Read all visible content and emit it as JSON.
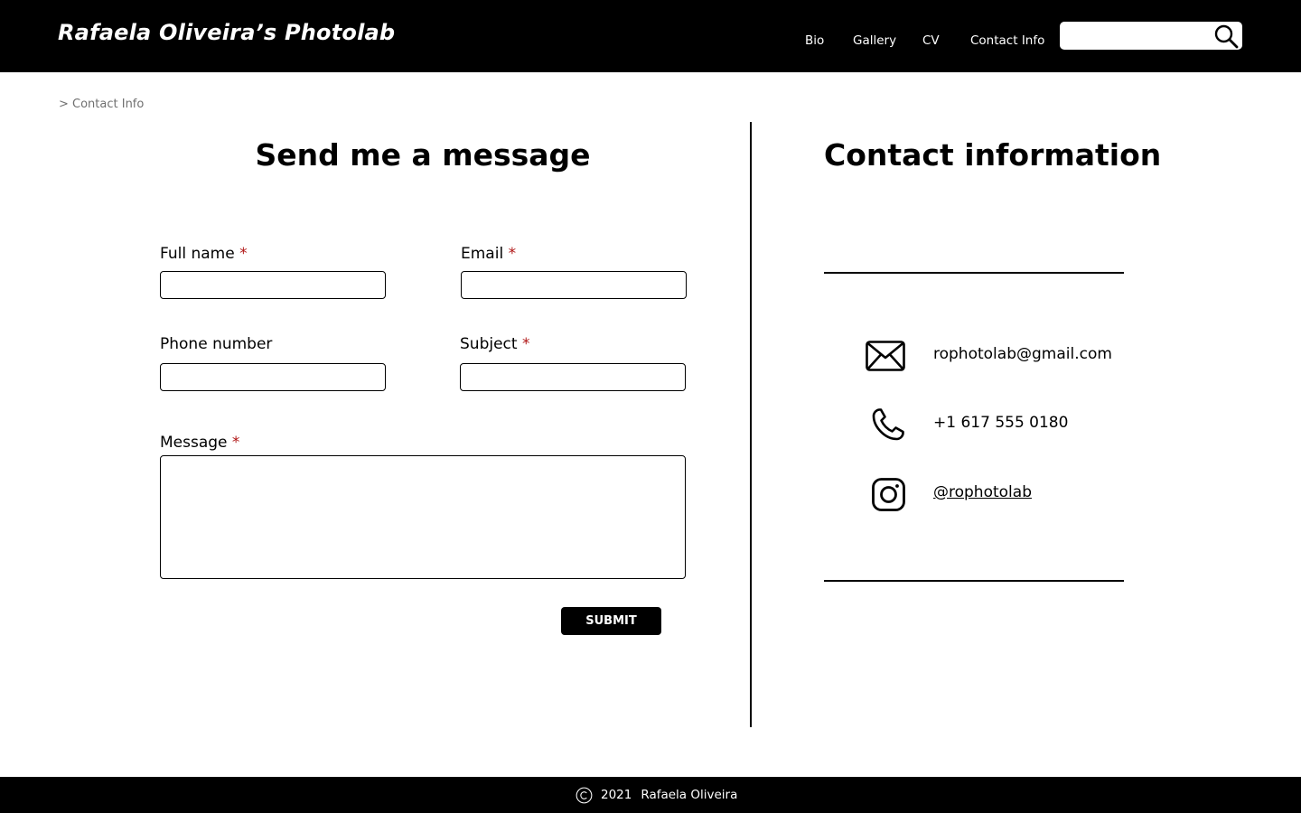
{
  "header": {
    "brand": "Rafaela Oliveira’s Photolab",
    "nav": [
      {
        "label": "Bio"
      },
      {
        "label": "Gallery"
      },
      {
        "label": "CV"
      },
      {
        "label": "Contact Info"
      }
    ],
    "search": {
      "value": "",
      "icon": "search-icon"
    }
  },
  "breadcrumb": "> Contact Info",
  "form": {
    "title": "Send me a message",
    "required_marker": "*",
    "fields": {
      "full_name": {
        "label": "Full name",
        "required": true,
        "value": ""
      },
      "email": {
        "label": "Email",
        "required": true,
        "value": ""
      },
      "phone": {
        "label": "Phone number",
        "required": false,
        "value": ""
      },
      "subject": {
        "label": "Subject",
        "required": true,
        "value": ""
      },
      "message": {
        "label": "Message",
        "required": true,
        "value": ""
      }
    },
    "submit_label": "SUBMIT"
  },
  "contact": {
    "title": "Contact information",
    "items": [
      {
        "icon": "envelope-icon",
        "text": "rophotolab@gmail.com"
      },
      {
        "icon": "phone-icon",
        "text": "+1 617 555 0180"
      },
      {
        "icon": "instagram-icon",
        "text": "@rophotolab"
      }
    ]
  },
  "footer": {
    "icon": "copyright-icon",
    "year": "2021",
    "name": "Rafaela Oliveira"
  },
  "colors": {
    "header_bg": "#000000",
    "required": "#b01515",
    "breadcrumb": "#6f6f6f"
  }
}
